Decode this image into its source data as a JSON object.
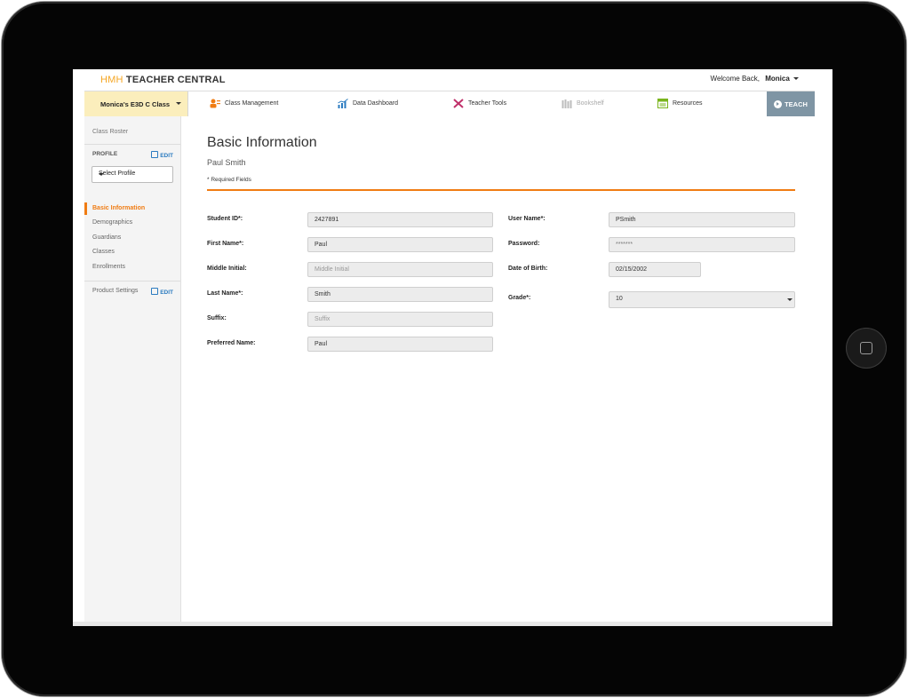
{
  "brand": {
    "prefix": "HMH",
    "name": "TEACHER CENTRAL",
    "prefix_color": "#f5a623"
  },
  "header": {
    "welcome_text": "Welcome Back,",
    "user_name": "Monica"
  },
  "nav": {
    "class_selector": "Monica's E3D C Class",
    "items": [
      {
        "label": "Class Management",
        "icon": "class-management-icon"
      },
      {
        "label": "Data Dashboard",
        "icon": "data-dashboard-icon"
      },
      {
        "label": "Teacher Tools",
        "icon": "teacher-tools-icon"
      },
      {
        "label": "Bookshelf",
        "icon": "bookshelf-icon"
      },
      {
        "label": "Resources",
        "icon": "resources-icon"
      }
    ],
    "teach_label": "TEACH",
    "teach_color": "#7f95a4"
  },
  "sidebar": {
    "class_roster": "Class Roster",
    "profile_label": "PROFILE",
    "edit_label": "EDIT",
    "select_profile": "Select Profile",
    "links": [
      "Basic Information",
      "Demographics",
      "Guardians",
      "Classes",
      "Enrollments"
    ],
    "active_link": "Basic Information",
    "product_settings": "Product Settings",
    "accent_color": "#f07c13"
  },
  "main": {
    "title": "Basic Information",
    "subtitle": "Paul Smith",
    "required_note": "* Required Fields",
    "left_fields": [
      {
        "label": "Student ID*:",
        "value": "2427891",
        "placeholder": ""
      },
      {
        "label": "First Name*:",
        "value": "Paul",
        "placeholder": ""
      },
      {
        "label": "Middle Initial:",
        "value": "",
        "placeholder": "Middle Initial"
      },
      {
        "label": "Last Name*:",
        "value": "Smith",
        "placeholder": ""
      },
      {
        "label": "Suffix:",
        "value": "",
        "placeholder": "Suffix"
      },
      {
        "label": "Preferred Name:",
        "value": "Paul",
        "placeholder": ""
      }
    ],
    "right_fields": [
      {
        "label": "User Name*:",
        "value": "PSmith"
      },
      {
        "label": "Password:",
        "value": "*******"
      },
      {
        "label": "Date of Birth:",
        "value": "02/15/2002"
      },
      {
        "label": "Grade*:",
        "value": "10"
      }
    ]
  }
}
